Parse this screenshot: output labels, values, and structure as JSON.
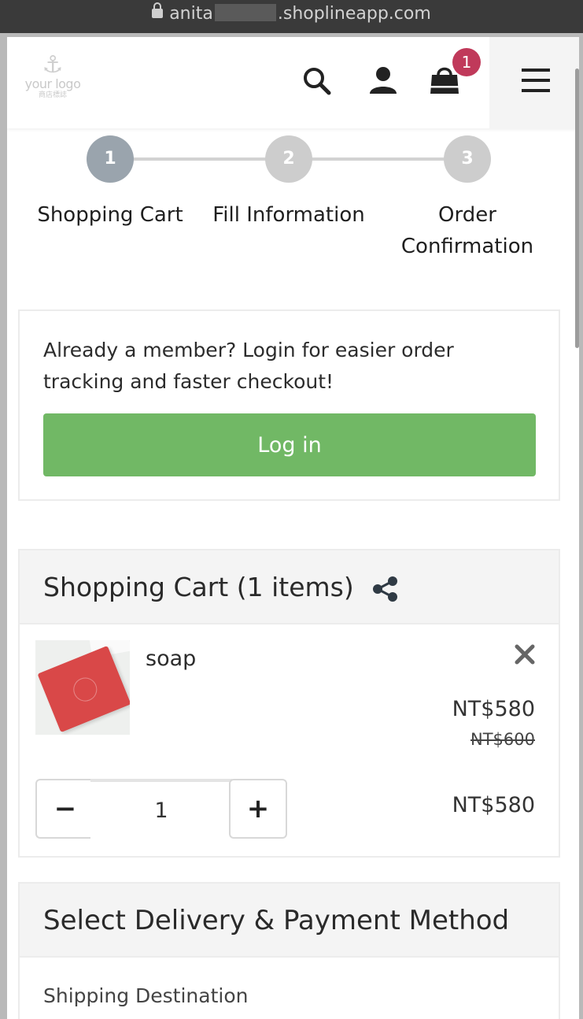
{
  "browser": {
    "url_prefix": "anita",
    "url_suffix": ".shoplineapp.com"
  },
  "header": {
    "logo_line1": "your logo",
    "logo_line2": "商店標誌",
    "cart_count": "1",
    "icons": [
      "search-icon",
      "user-icon",
      "cart-bag-icon",
      "hamburger-menu-icon"
    ]
  },
  "steps": [
    {
      "number": "1",
      "label": "Shopping Cart",
      "active": true
    },
    {
      "number": "2",
      "label": "Fill Information",
      "active": false
    },
    {
      "number": "3",
      "label": "Order Confirmation",
      "active": false
    }
  ],
  "member": {
    "message": "Already a member? Login for easier order tracking and faster checkout!",
    "login_label": "Log in"
  },
  "cart": {
    "title": "Shopping Cart  (1 items)",
    "items": [
      {
        "name": "soap",
        "price": "NT$580",
        "original_price": "NT$600",
        "quantity": "1",
        "line_total": "NT$580"
      }
    ]
  },
  "delivery": {
    "title": "Select Delivery & Payment Method",
    "shipping_label": "Shipping Destination"
  },
  "colors": {
    "login_button": "#71b865",
    "badge": "#c0395a",
    "active_step": "#9aa4ad",
    "inactive_step": "#cdcdcd"
  }
}
